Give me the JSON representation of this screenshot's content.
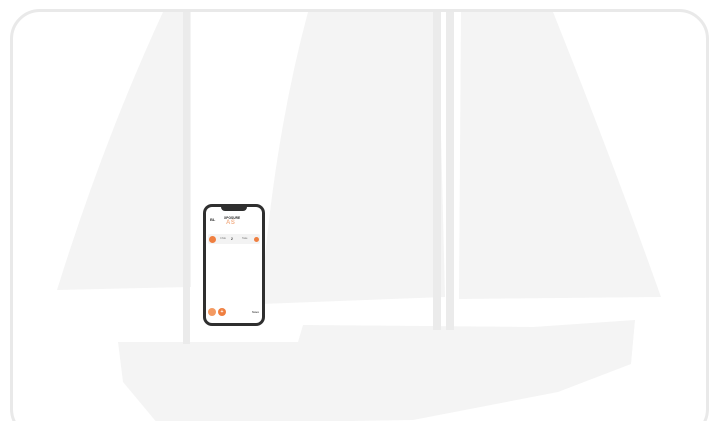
{
  "scene": {
    "background_color": "#ffffff",
    "frame_border_color": "#e9e9e9",
    "silhouette_color": "#f4f4f4",
    "silhouette_icon": "sailboat-icon"
  },
  "phone": {
    "header": {
      "back_label": "BL",
      "brand_name": "XPOSURE",
      "brand_sub": "AS"
    },
    "toolbar": {
      "label_left": "Chile",
      "value": "2",
      "label_right": "Take"
    },
    "actions": {
      "fab_1_icon": "refresh-icon",
      "fab_2_icon": "add-icon",
      "fab_2_label": "+",
      "bottom_label": "Save"
    },
    "accent_color": "#ef7f40"
  }
}
